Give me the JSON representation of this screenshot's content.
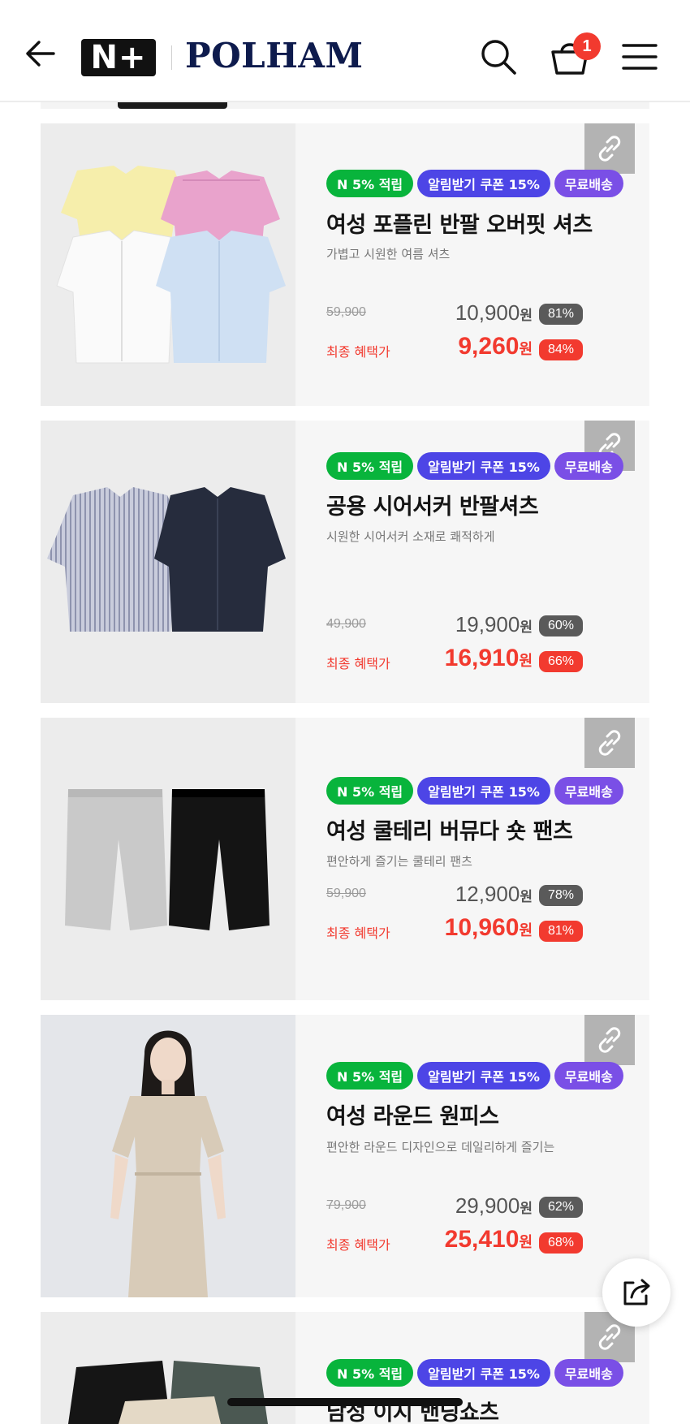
{
  "header": {
    "nplus_logo": "N+",
    "brand": "POLHAM",
    "cart_count": "1"
  },
  "icons": {
    "back": "arrow-left-icon",
    "search": "search-icon",
    "cart": "shopping-bag-icon",
    "menu": "hamburger-menu-icon",
    "link": "link-icon",
    "share": "share-icon"
  },
  "colors": {
    "accent_red": "#f23a2f",
    "badge_green": "#08b43c",
    "badge_blue": "#4d45e6",
    "badge_purple": "#7a4fe6",
    "brand_navy": "#0e1b4d"
  },
  "badges": {
    "points": "N 5% 적립",
    "coupon": "알림받기 쿠폰 15%",
    "shipping": "무료배송"
  },
  "final_label": "최종 혜택가",
  "currency": "원",
  "products": [
    {
      "name": "여성 포플린 반팔 오버핏 셔츠",
      "desc": "가볍고 시원한 여름 셔츠",
      "original_price": "59,900",
      "sale_price": "10,900",
      "sale_pct": "81%",
      "final_price": "9,260",
      "final_pct": "84%"
    },
    {
      "name": "공용 시어서커 반팔셔츠",
      "desc": "시원한 시어서커 소재로 쾌적하게",
      "original_price": "49,900",
      "sale_price": "19,900",
      "sale_pct": "60%",
      "final_price": "16,910",
      "final_pct": "66%"
    },
    {
      "name": "여성 쿨테리 버뮤다 숏 팬츠",
      "desc": "편안하게 즐기는 쿨테리 팬츠",
      "original_price": "59,900",
      "sale_price": "12,900",
      "sale_pct": "78%",
      "final_price": "10,960",
      "final_pct": "81%"
    },
    {
      "name": "여성 라운드 원피스",
      "desc": "편안한 라운드 디자인으로 데일리하게 즐기는",
      "original_price": "79,900",
      "sale_price": "29,900",
      "sale_pct": "62%",
      "final_price": "25,410",
      "final_pct": "68%"
    },
    {
      "name": "남성 이지 밴딩쇼츠"
    }
  ]
}
